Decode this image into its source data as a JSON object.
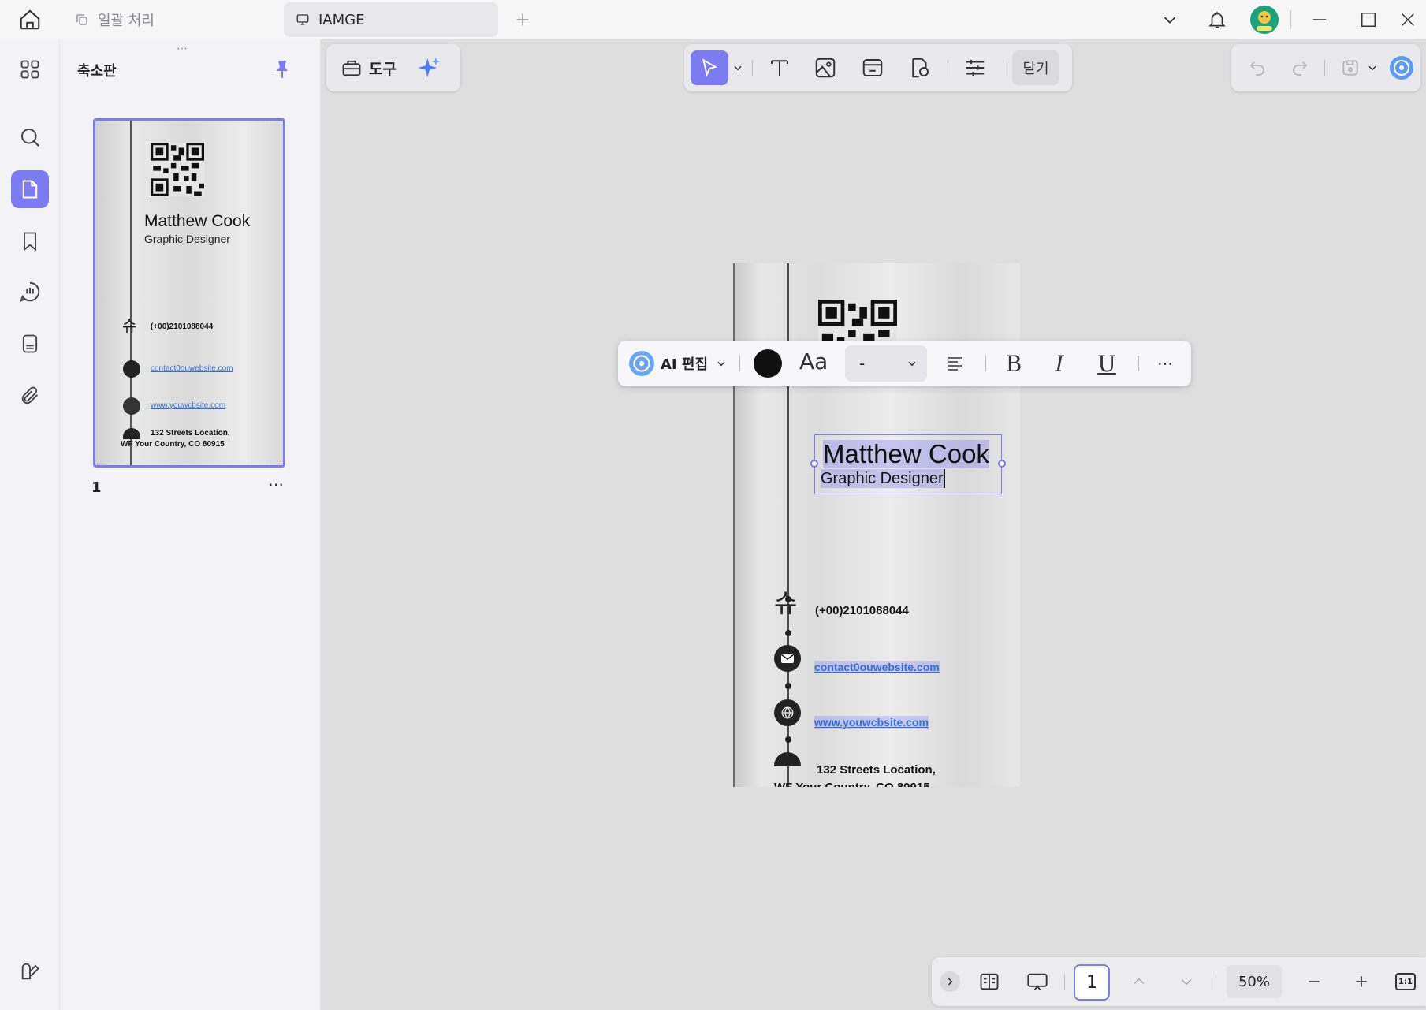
{
  "titlebar": {
    "tabs": [
      {
        "label": "일괄 처리",
        "active": false,
        "icon": "copy-icon"
      },
      {
        "label": "IAMGE",
        "active": true,
        "icon": "monitor-icon"
      }
    ]
  },
  "thumbnail_panel": {
    "title": "축소판",
    "page_number": "1"
  },
  "tools": {
    "label": "도구"
  },
  "main_toolbar": {
    "close_label": "닫기"
  },
  "text_toolbar": {
    "ai_label": "AI 편집",
    "aa_label": "Aa",
    "size_value": "-",
    "text_color": "#111111"
  },
  "document": {
    "name": "Matthew Cook",
    "role": "Graphic Designer",
    "phone": "(+00)2101088044",
    "email": "contact0ouwebsite.com",
    "website": "www.youwcbsite.com",
    "address_line1": "132 Streets Location,",
    "address_line2": "WF Your Country, CO 80915",
    "phone_glyph": "슈"
  },
  "bottombar": {
    "page_value": "1",
    "zoom": "50%",
    "fit_label": "1:1"
  },
  "colors": {
    "accent": "#7b7bf2",
    "link": "#2f6fd6"
  }
}
